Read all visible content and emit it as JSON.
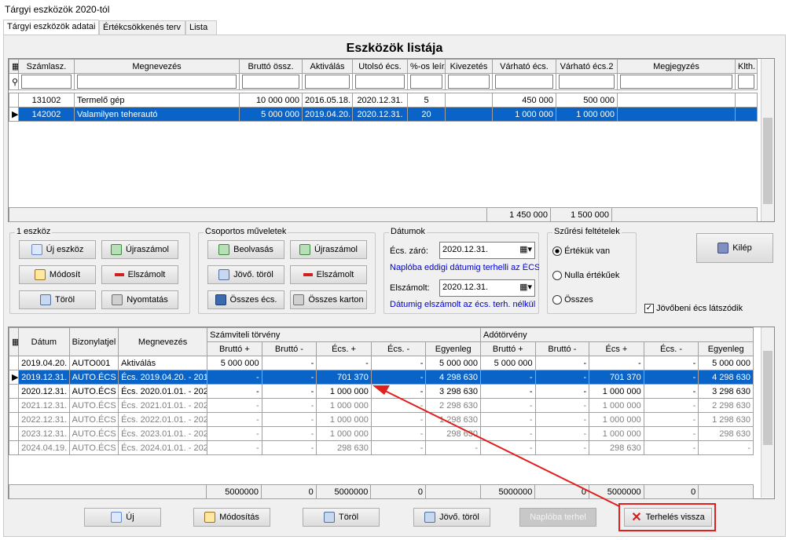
{
  "window": {
    "title": "Tárgyi eszközök 2020-tól"
  },
  "tabs": [
    "Tárgyi eszközök adatai",
    "Értékcsökkenés terv",
    "Lista"
  ],
  "list": {
    "title": "Eszközök listája",
    "headers": [
      "Számlasz.",
      "Megnevezés",
      "Bruttó össz.",
      "Aktiválás",
      "Utolsó écs.",
      "%-os leír.",
      "Kivezetés",
      "Várható écs.",
      "Várható écs.2",
      "Megjegyzés",
      "Klth."
    ],
    "rows": [
      [
        "131002",
        "Termelő gép",
        "10 000 000",
        "2016.05.18.",
        "2020.12.31.",
        "5",
        "",
        "450 000",
        "500 000",
        "",
        ""
      ],
      [
        "142002",
        "Valamilyen teherautó",
        "5 000 000",
        "2019.04.20.",
        "2020.12.31.",
        "20",
        "",
        "1 000 000",
        "1 000 000",
        "",
        ""
      ]
    ],
    "totals": {
      "v1": "1 450 000",
      "v2": "1 500 000"
    }
  },
  "groups": {
    "one": {
      "label": "1 eszköz",
      "buttons": [
        "Új eszköz",
        "Újraszámol",
        "Módosít",
        "Elszámolt",
        "Töröl",
        "Nyomtatás"
      ]
    },
    "bulk": {
      "label": "Csoportos műveletek",
      "buttons": [
        "Beolvasás",
        "Újraszámol",
        "Jövő. töröl",
        "Elszámolt",
        "Összes écs.",
        "Összes karton"
      ]
    },
    "dates": {
      "label": "Dátumok",
      "close_label": "Écs. záró:",
      "close_value": "2020.12.31.",
      "note1": "Naplóba eddigi dátumig terhelli az ÉCS-t",
      "settled_label": "Elszámolt:",
      "settled_value": "2020.12.31.",
      "note2": "Dátumig elszámolt az écs. terh. nélkül"
    },
    "filter": {
      "label": "Szűrési feltételek",
      "options": [
        "Értékük van",
        "Nulla értékűek",
        "Összes"
      ],
      "selected": 0
    },
    "future_check": "Jövőbeni écs látszódik",
    "exit": "Kilép"
  },
  "ledger": {
    "headers": {
      "date": "Dátum",
      "doc": "Bizonylatjel",
      "name": "Megnevezés",
      "acc": "Számviteli törvény",
      "tax": "Adótörvény"
    },
    "sub": [
      "Bruttó +",
      "Bruttó -",
      "Écs. +",
      "Écs. -",
      "Egyenleg",
      "Bruttó +",
      "Bruttó -",
      "Écs +",
      "Écs. -",
      "Egyenleg"
    ],
    "rows": [
      {
        "d": "2019.04.20.",
        "b": "AUTO001",
        "m": "Aktiválás",
        "v": [
          "5 000 000",
          "-",
          "-",
          "-",
          "5 000 000",
          "5 000 000",
          "-",
          "-",
          "-",
          "5 000 000"
        ],
        "style": ""
      },
      {
        "d": "2019.12.31.",
        "b": "AUTO.ÉCS",
        "m": "Écs. 2019.04.20. - 201",
        "v": [
          "-",
          "-",
          "701 370",
          "-",
          "4 298 630",
          "-",
          "-",
          "701 370",
          "-",
          "4 298 630"
        ],
        "style": "sel"
      },
      {
        "d": "2020.12.31.",
        "b": "AUTO.ÉCS",
        "m": "Écs. 2020.01.01. - 202",
        "v": [
          "-",
          "-",
          "1 000 000",
          "-",
          "3 298 630",
          "-",
          "-",
          "1 000 000",
          "-",
          "3 298 630"
        ],
        "style": ""
      },
      {
        "d": "2021.12.31.",
        "b": "AUTO.ÉCS",
        "m": "Écs. 2021.01.01. - 202",
        "v": [
          "-",
          "-",
          "1 000 000",
          "-",
          "2 298 630",
          "-",
          "-",
          "1 000 000",
          "-",
          "2 298 630"
        ],
        "style": "grey"
      },
      {
        "d": "2022.12.31.",
        "b": "AUTO.ÉCS",
        "m": "Écs. 2022.01.01. - 202",
        "v": [
          "-",
          "-",
          "1 000 000",
          "-",
          "1 298 630",
          "-",
          "-",
          "1 000 000",
          "-",
          "1 298 630"
        ],
        "style": "grey"
      },
      {
        "d": "2023.12.31.",
        "b": "AUTO.ÉCS",
        "m": "Écs. 2023.01.01. - 202",
        "v": [
          "-",
          "-",
          "1 000 000",
          "-",
          "298 630",
          "-",
          "-",
          "1 000 000",
          "-",
          "298 630"
        ],
        "style": "grey"
      },
      {
        "d": "2024.04.19.",
        "b": "AUTO.ÉCS",
        "m": "Écs. 2024.01.01. - 202",
        "v": [
          "-",
          "-",
          "298 630",
          "-",
          "-",
          "-",
          "-",
          "298 630",
          "-",
          "-"
        ],
        "style": "grey"
      }
    ],
    "totals": [
      "5000000",
      "0",
      "5000000",
      "0",
      "",
      "5000000",
      "0",
      "5000000",
      "0",
      ""
    ]
  },
  "bottom_buttons": [
    "Új",
    "Módosítás",
    "Töröl",
    "Jövő. töröl",
    "Naplóba terhel",
    "Terhelés vissza"
  ],
  "colors": {
    "selection": "#0a64c8",
    "highlight": "#e02020"
  }
}
